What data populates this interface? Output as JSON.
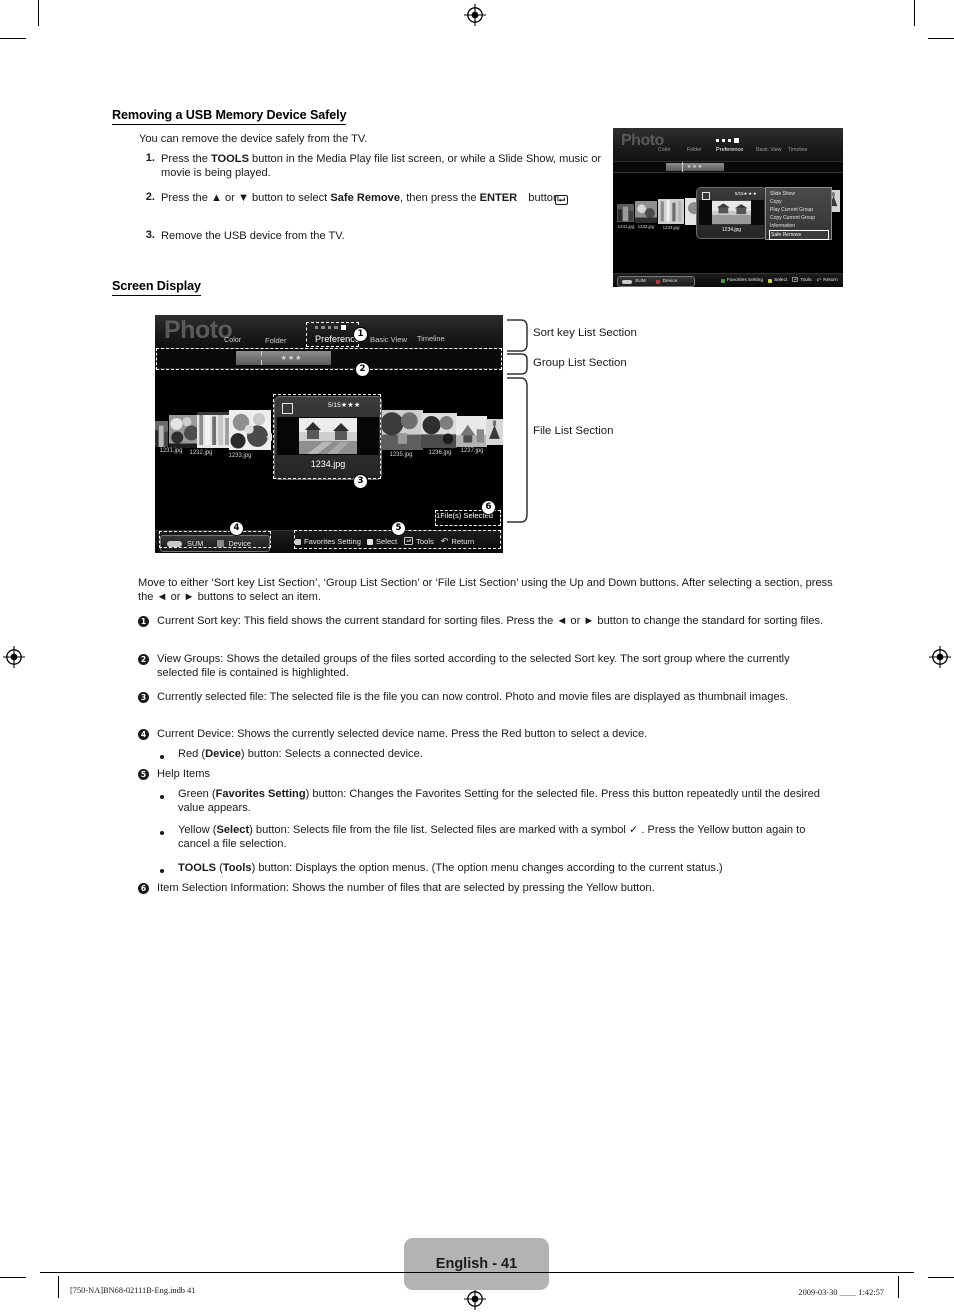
{
  "page": {
    "badge": "English - 41",
    "footer_left": "[750-NA]BN68-02111B-Eng.indb   41",
    "footer_right": "2009-03-30   ＿＿ 1:42:57"
  },
  "sections": {
    "usb": {
      "heading": "Removing a USB Memory Device Safely",
      "intro": "You can remove the device safely from the TV.",
      "steps": [
        {
          "num": "1.",
          "html": "Press the <b>TOOLS</b> button in the Media Play file list screen, or while a Slide Show, music or movie is being played."
        },
        {
          "num": "2.",
          "html": "Press the ▲ or ▼ button to select <b>Safe Remove</b>, then press the <b>ENTER</b> button."
        },
        {
          "num": "3.",
          "html": "Remove the USB device from the TV."
        }
      ]
    },
    "screen_display": {
      "heading": "Screen Display",
      "intro": "Move to either ‘Sort key List Section’, ‘Group List Section’ or ‘File List Section’ using the Up and Down buttons. After selecting a section, press the ◄ or ► buttons to select an item.",
      "items": [
        {
          "num": "1",
          "html": "Current Sort key: This field shows the current standard for sorting files. Press the ◄ or ► button to change the standard for sorting files."
        },
        {
          "num": "2",
          "html": "View Groups: Shows the detailed groups of the files sorted according to the selected Sort key. The sort group where the currently selected file is contained is highlighted."
        },
        {
          "num": "3",
          "html": "Currently selected file: The selected file is the file you can now control. Photo and movie files are displayed as thumbnail images."
        },
        {
          "num": "4",
          "html": "Current Device: Shows the currently selected device name. Press the Red button to select a device."
        },
        {
          "num": "5",
          "html": "Help Items"
        },
        {
          "num": "6",
          "html": "Item Selection Information: Shows the number of files that are selected by pressing the Yellow button."
        }
      ],
      "sub_bullets": [
        {
          "after": "4",
          "html": "Red (<b>Device</b>) button: Selects a connected device."
        },
        {
          "after": "5",
          "html": "Green (<b>Favorites Setting</b>) button: Changes the Favorites Setting for the selected file. Press this button repeatedly until the desired value appears."
        },
        {
          "after": "5",
          "html": "Yellow (<b>Select</b>) button: Selects file from the file list. Selected files are marked with a symbol ✓ . Press the Yellow button again to cancel a file selection."
        },
        {
          "after": "5",
          "html": "<b>TOOLS</b> (<b>Tools</b>) button: Displays the option menus. (The option menu changes according to the current status.)"
        }
      ]
    }
  },
  "diagram": {
    "bracket_labels": [
      "Sort key List Section",
      "Group List Section",
      "File List Section"
    ],
    "callouts": [
      "1",
      "2",
      "3",
      "4",
      "5",
      "6"
    ]
  },
  "tv_screen": {
    "title": "Photo",
    "sort_keys": [
      "Color",
      "Folder",
      "Preference",
      "Basic View",
      "Timeline"
    ],
    "active_sort_key": "Preference",
    "dot_count": 5,
    "active_dot_index": 4,
    "group_stars": "★★★",
    "thumbnails": [
      {
        "label": "1231.jpg"
      },
      {
        "label": "1232.jpg"
      },
      {
        "label": "1233.jpg"
      },
      {
        "label": "1235.jpg"
      },
      {
        "label": "1236.jpg"
      },
      {
        "label": "1237.jpg"
      }
    ],
    "selected_file": {
      "name": "1234.jpg",
      "count": "5/15",
      "stars": "★★★"
    },
    "device_bar": {
      "source_label": "SUM",
      "device_label": "Device"
    },
    "help_items": [
      {
        "key_color": "#3aa03a",
        "label": "Favorites Setting"
      },
      {
        "key_color": "#d8d83a",
        "label": "Select"
      },
      {
        "key_color": "",
        "label": "Tools",
        "icon": "tools-icon"
      },
      {
        "key_color": "",
        "label": "Return",
        "icon": "return-icon"
      }
    ],
    "selection_info": "1File(s) Selected"
  },
  "tv_screen_small": {
    "title": "Photo",
    "sort_keys": [
      "Color",
      "Folder",
      "Preference",
      "Basic View",
      "Timeline"
    ],
    "active_sort_key": "Preference",
    "thumbnails": [
      {
        "label": "1231.jpg"
      },
      {
        "label": "1232.jpg"
      },
      {
        "label": "1233.jpg"
      }
    ],
    "selected_file": {
      "name": "1234.jpg",
      "count": "5/15",
      "stars": "★★★"
    },
    "tools_menu": {
      "items": [
        "Slide Show",
        "Copy",
        "Play Current Group",
        "Copy Current Group",
        "Information",
        "Safe Remove"
      ],
      "highlighted": "Safe Remove"
    },
    "device_bar": {
      "source_label": "SUM",
      "device_label": "Device"
    },
    "help_items": [
      "Favorites Setting",
      "Select",
      "Tools",
      "Return"
    ]
  }
}
